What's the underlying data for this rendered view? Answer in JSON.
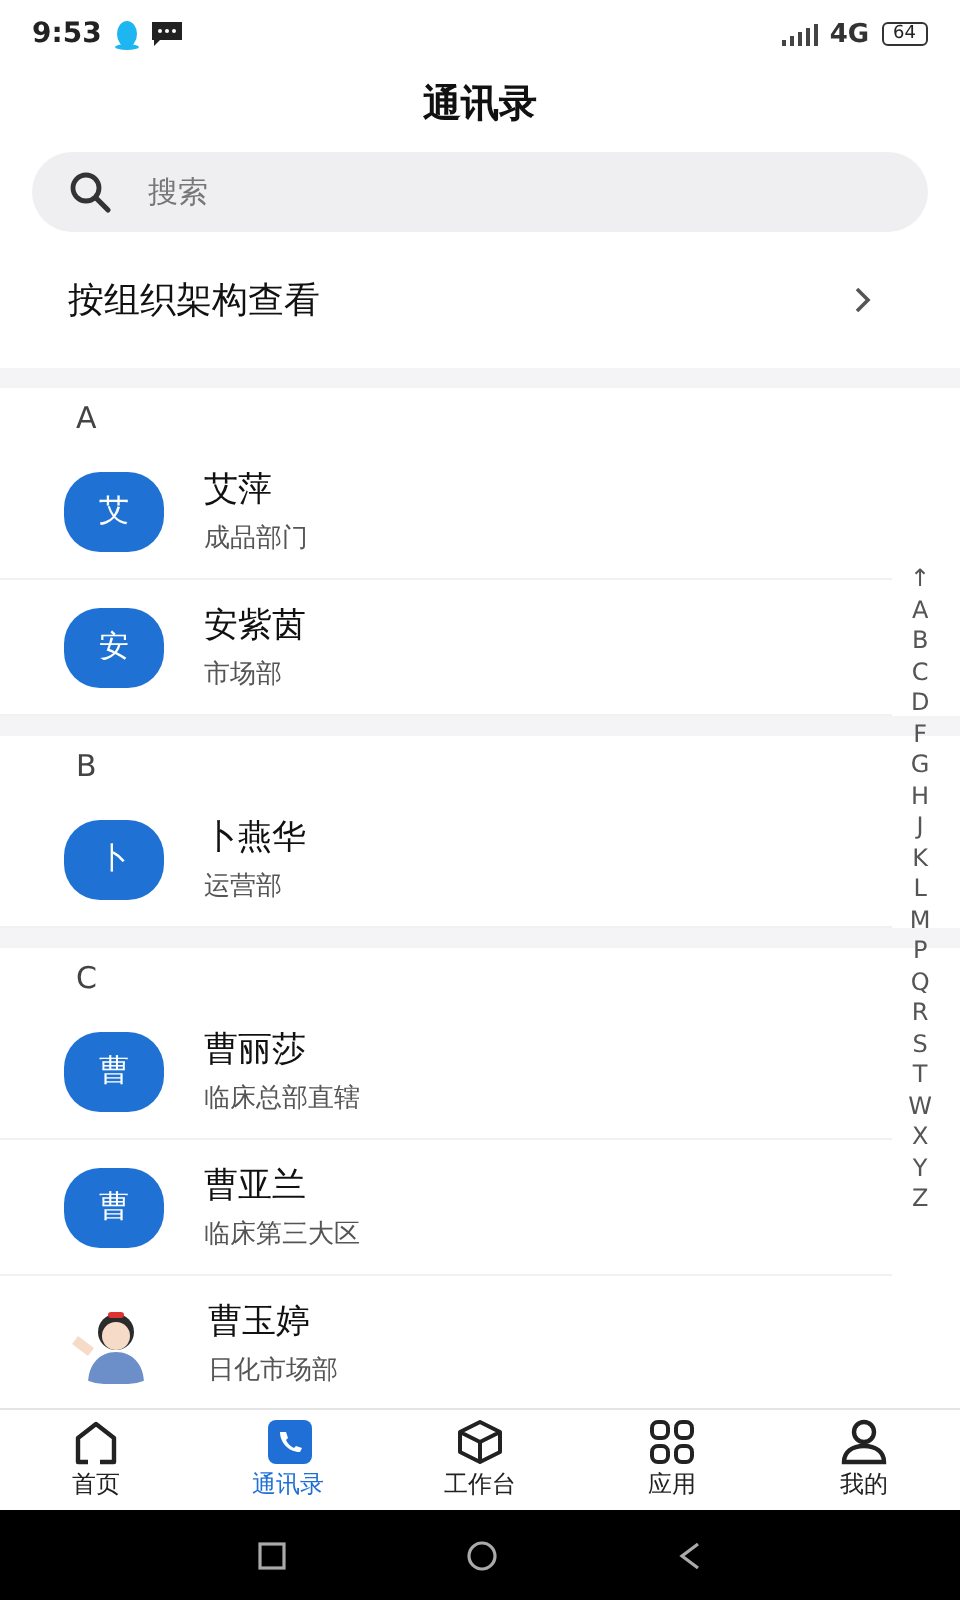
{
  "status_bar": {
    "time": "9:53",
    "network": "4G",
    "battery": "64"
  },
  "title": "通讯录",
  "search": {
    "placeholder": "搜索"
  },
  "org_link": {
    "label": "按组织架构查看"
  },
  "sections": [
    {
      "letter": "A",
      "contacts": [
        {
          "kind": "letter",
          "initial": "艾",
          "name": "艾萍",
          "department": "成品部门"
        },
        {
          "kind": "letter",
          "initial": "安",
          "name": "安紫茵",
          "department": "市场部"
        }
      ]
    },
    {
      "letter": "B",
      "contacts": [
        {
          "kind": "letter",
          "initial": "卜",
          "name": "卜燕华",
          "department": "运营部"
        }
      ]
    },
    {
      "letter": "C",
      "contacts": [
        {
          "kind": "letter",
          "initial": "曹",
          "name": "曹丽莎",
          "department": "临床总部直辖"
        },
        {
          "kind": "letter",
          "initial": "曹",
          "name": "曹亚兰",
          "department": "临床第三大区"
        },
        {
          "kind": "picture",
          "name": "曹玉婷",
          "department": "日化市场部"
        }
      ]
    }
  ],
  "index": [
    "↑",
    "A",
    "B",
    "C",
    "D",
    "F",
    "G",
    "H",
    "J",
    "K",
    "L",
    "M",
    "P",
    "Q",
    "R",
    "S",
    "T",
    "W",
    "X",
    "Y",
    "Z"
  ],
  "tabs": [
    {
      "label": "首页",
      "selected": false
    },
    {
      "label": "通讯录",
      "selected": true
    },
    {
      "label": "工作台",
      "selected": false
    },
    {
      "label": "应用",
      "selected": false
    },
    {
      "label": "我的",
      "selected": false
    }
  ]
}
